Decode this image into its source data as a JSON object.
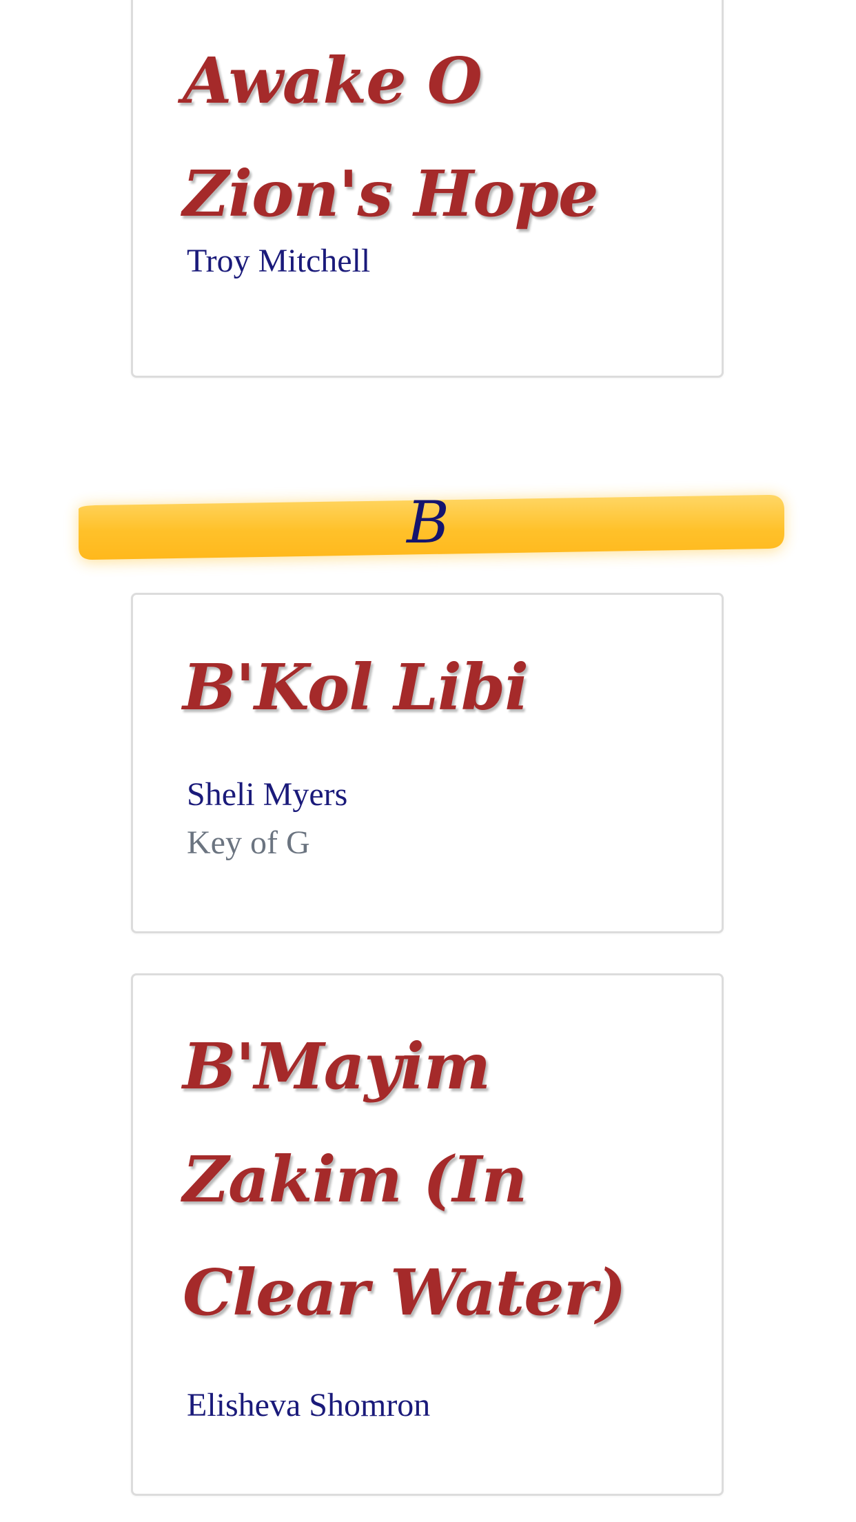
{
  "songs_top": [
    {
      "title": "Awake O Zion's Hope",
      "artist": "Troy Mitchell"
    }
  ],
  "section_b": {
    "letter": "B",
    "colors": {
      "banner": "#ffc12a",
      "letter": "#14146e"
    },
    "songs": [
      {
        "title": "B'Kol Libi",
        "artist": "Sheli Myers",
        "key": "Key of G"
      },
      {
        "title": "B'Mayim Zakim (In Clear Water)",
        "artist": "Elisheva Shomron"
      }
    ]
  },
  "colors": {
    "title": "#a52a2a",
    "artist": "#1a1a7a",
    "key": "#6b7480",
    "card_border": "#dcdcdc"
  }
}
